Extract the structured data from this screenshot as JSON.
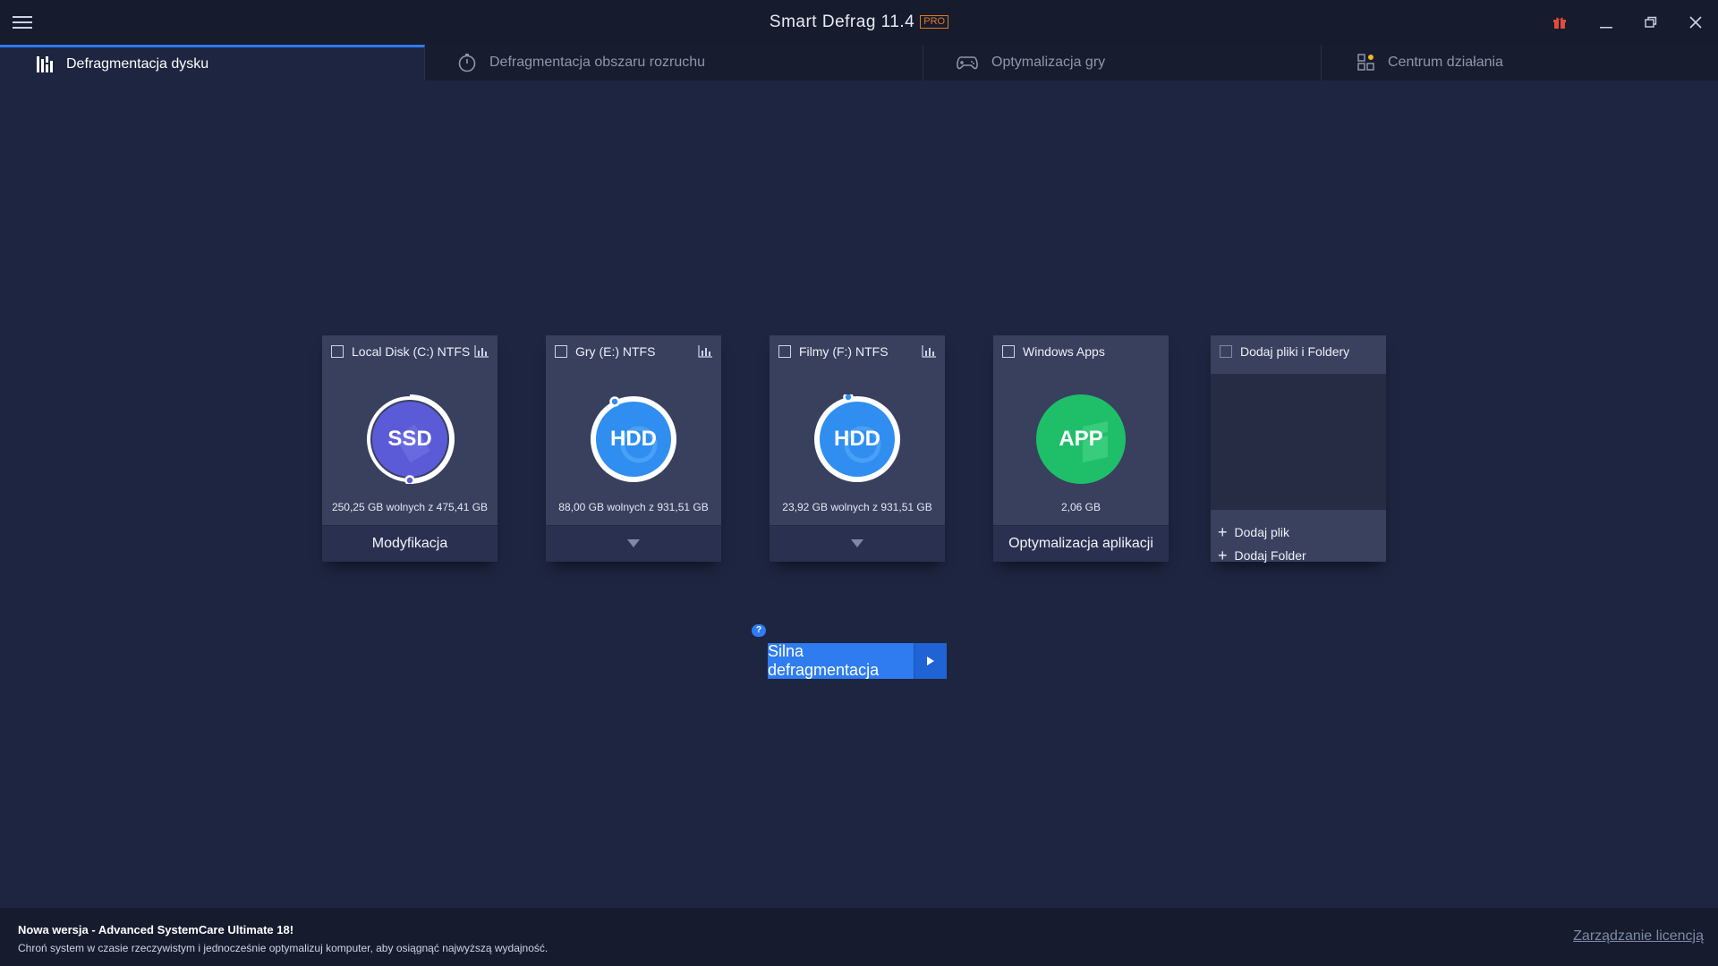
{
  "window": {
    "title": "Smart Defrag 11.4",
    "badge": "PRO",
    "accent_color": "#2e7cf0",
    "badge_color": "#e07a1f"
  },
  "tabs": [
    {
      "label": "Defragmentacja dysku",
      "icon": "defrag-bars-icon",
      "active": true
    },
    {
      "label": "Defragmentacja obszaru rozruchu",
      "icon": "stopwatch-icon",
      "active": false
    },
    {
      "label": "Optymalizacja gry",
      "icon": "gamepad-icon",
      "active": false
    },
    {
      "label": "Centrum działania",
      "icon": "grid-apps-icon",
      "active": false
    }
  ],
  "drives": [
    {
      "label": "Local Disk (C:) NTFS",
      "type": "SSD",
      "free": "250,25 GB wolnych z 475,41 GB",
      "footer": "Modyfikacja",
      "color": "#5b5bd8"
    },
    {
      "label": "Gry (E:) NTFS",
      "type": "HDD",
      "free": "88,00 GB wolnych z 931,51 GB",
      "footer": "",
      "color": "#2f8ef0"
    },
    {
      "label": "Filmy (F:) NTFS",
      "type": "HDD",
      "free": "23,92 GB wolnych z 931,51 GB",
      "footer": "",
      "color": "#2f8ef0"
    },
    {
      "label": "Windows Apps",
      "type": "APP",
      "free": "2,06 GB",
      "footer": "Optymalizacja aplikacji",
      "color": "#1fbf6a"
    }
  ],
  "add_card": {
    "label": "Dodaj pliki i Foldery",
    "add_file": "Dodaj plik",
    "add_folder": "Dodaj Folder"
  },
  "action": {
    "help": "?",
    "button_label": "Silna defragmentacja"
  },
  "footer": {
    "title": "Nowa wersja - Advanced SystemCare Ultimate 18!",
    "description": "Chroń system w czasie rzeczywistym i jednocześnie optymalizuj komputer, aby osiągnąć najwyższą wydajność.",
    "license_link": "Zarządzanie licencją"
  }
}
